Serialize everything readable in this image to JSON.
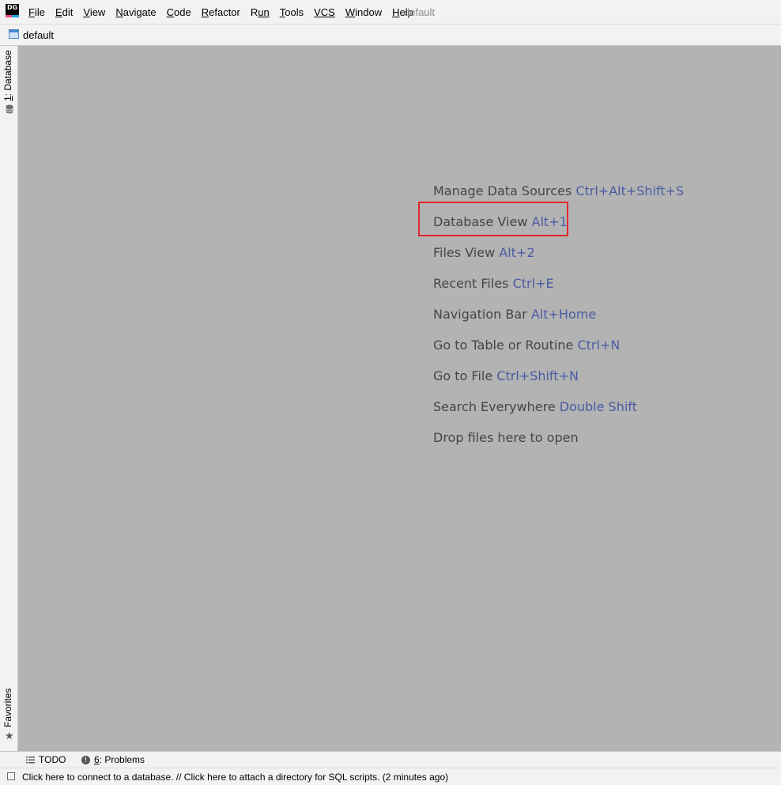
{
  "app": {
    "logo_text": "DG",
    "window_title": "default"
  },
  "menu": [
    {
      "mnemonic": "F",
      "rest": "ile"
    },
    {
      "mnemonic": "E",
      "rest": "dit"
    },
    {
      "mnemonic": "V",
      "rest": "iew"
    },
    {
      "mnemonic": "N",
      "rest": "avigate"
    },
    {
      "mnemonic": "C",
      "rest": "ode"
    },
    {
      "mnemonic": "R",
      "rest": "efactor"
    },
    {
      "mnemonic": "R",
      "rest": "un",
      "split": "Ru",
      "post": "n"
    },
    {
      "mnemonic": "T",
      "rest": "ools"
    },
    {
      "mnemonic": "VCS",
      "rest": ""
    },
    {
      "mnemonic": "W",
      "rest": "indow"
    },
    {
      "mnemonic": "H",
      "rest": "elp"
    }
  ],
  "navbar": {
    "project_label": "default"
  },
  "left_stripe": {
    "database_tab": {
      "mnemonic": "1",
      "rest": ": Database"
    },
    "favorites_tab": "Favorites"
  },
  "editor": {
    "hints": [
      {
        "action": "Manage Data Sources",
        "shortcut": "Ctrl+Alt+Shift+S"
      },
      {
        "action": "Database View",
        "shortcut": "Alt+1"
      },
      {
        "action": "Files View",
        "shortcut": "Alt+2"
      },
      {
        "action": "Recent Files",
        "shortcut": "Ctrl+E"
      },
      {
        "action": "Navigation Bar",
        "shortcut": "Alt+Home"
      },
      {
        "action": "Go to Table or Routine",
        "shortcut": "Ctrl+N"
      },
      {
        "action": "Go to File",
        "shortcut": "Ctrl+Shift+N"
      },
      {
        "action": "Search Everywhere",
        "shortcut": "Double Shift"
      },
      {
        "action": "Drop files here to open",
        "shortcut": ""
      }
    ]
  },
  "bottom_stripe": {
    "todo_label": "TODO",
    "problems": {
      "mnemonic": "6",
      "rest": ": Problems"
    }
  },
  "statusbar": {
    "text": "Click here to connect to a database. // Click here to attach a directory for SQL scripts. (2 minutes ago)"
  },
  "colors": {
    "editor_bg": "#b3b3b3",
    "hint_text": "#454545",
    "shortcut_text": "#4b5ba3",
    "highlight": "#e0282e"
  }
}
